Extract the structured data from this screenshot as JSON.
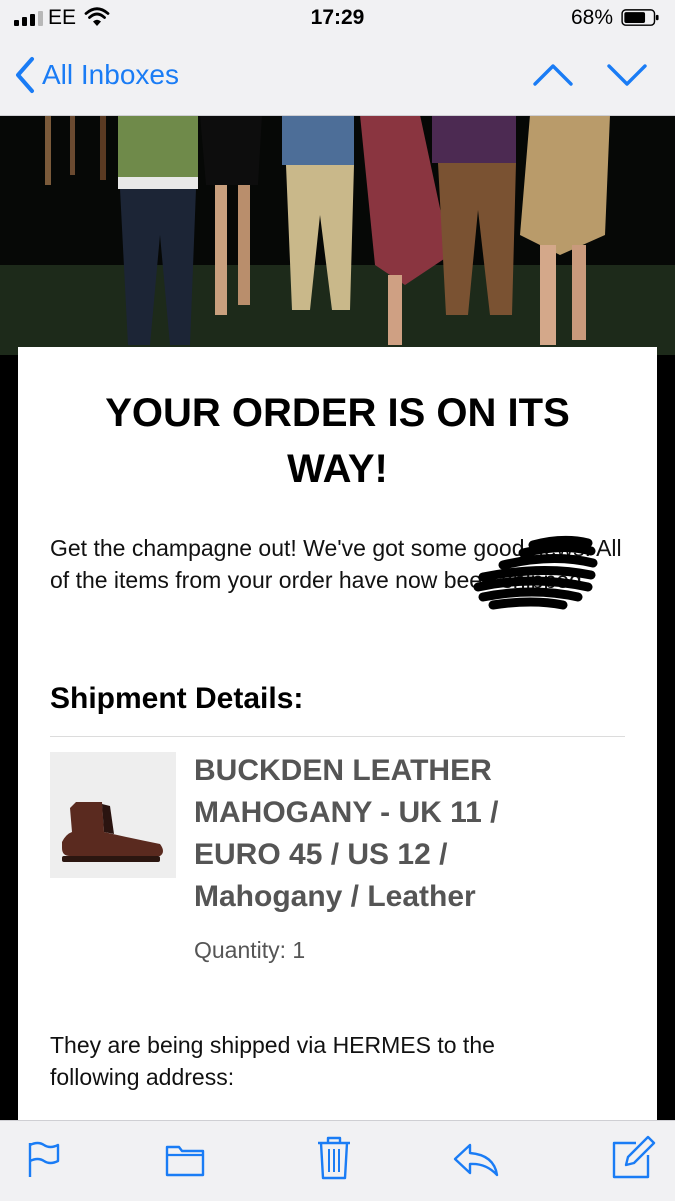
{
  "status": {
    "carrier": "EE",
    "time": "17:29",
    "battery": "68%"
  },
  "nav": {
    "back_label": "All Inboxes"
  },
  "email": {
    "headline_line1": "YOUR ORDER IS ON ITS",
    "headline_line2": "WAY!",
    "intro": "Get the champagne out! We've got some good news! All of the items from your order have now been shipped.",
    "section_title": "Shipment Details:",
    "product": {
      "title_line1": "BUCKDEN LEATHER",
      "title_line2": "MAHOGANY - UK 11 /",
      "title_line3": "EURO 45 / US 12 /",
      "title_line4": "Mahogany / Leather",
      "quantity": "Quantity: 1"
    },
    "shipping_line1": "They are being shipped via HERMES to the",
    "shipping_line2": "following address:"
  },
  "colors": {
    "accent": "#1a7cf5",
    "product_text": "#555555",
    "shoe": "#5a2a1f"
  },
  "icons": [
    "chevron-left-icon",
    "chevron-up-icon",
    "chevron-down-icon",
    "flag-icon",
    "folder-icon",
    "trash-icon",
    "reply-icon",
    "compose-icon",
    "wifi-icon",
    "battery-icon",
    "signal-icon"
  ]
}
